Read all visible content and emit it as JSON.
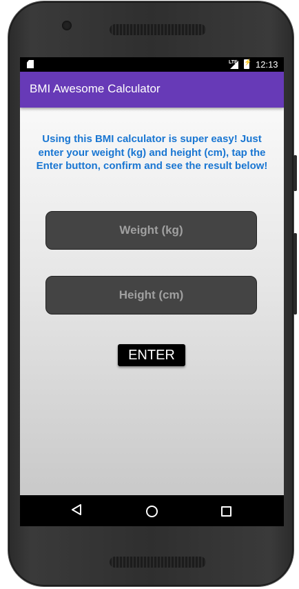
{
  "status_bar": {
    "time": "12:13",
    "network": "LTE"
  },
  "app_bar": {
    "title": "BMI Awesome Calculator",
    "color": "#673ab7"
  },
  "main": {
    "instructions": "Using this BMI calculator is super easy! Just enter your weight (kg) and height (cm), tap the Enter button, confirm and see the result below!",
    "weight_field": {
      "placeholder": "Weight (kg)",
      "value": ""
    },
    "height_field": {
      "placeholder": "Height (cm)",
      "value": ""
    },
    "enter_button": "ENTER"
  },
  "colors": {
    "instruction_text": "#1976d2",
    "field_background": "#444444"
  },
  "nav_bar": {
    "icons": [
      "back-icon",
      "home-icon",
      "recents-icon"
    ]
  }
}
